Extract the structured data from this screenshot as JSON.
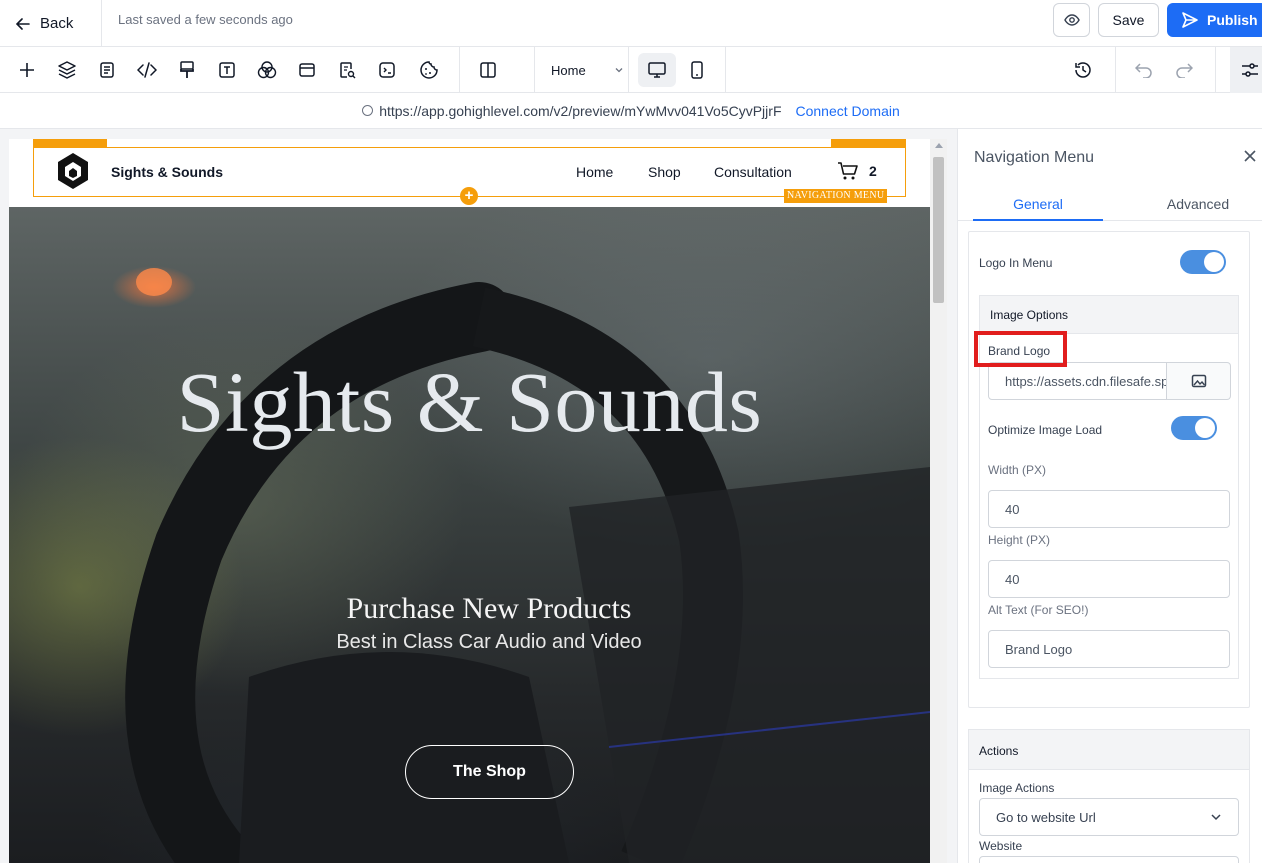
{
  "topbar": {
    "back_label": "Back",
    "saved_status": "Last saved a few seconds ago",
    "save_label": "Save",
    "publish_label": "Publish"
  },
  "toolbar": {
    "page_select": "Home"
  },
  "urlbar": {
    "url": "https://app.gohighlevel.com/v2/preview/mYwMvv041Vo5CyvPjjrF",
    "connect_label": "Connect Domain"
  },
  "site": {
    "brand": "Sights & Sounds",
    "menu": [
      "Home",
      "Shop",
      "Consultation"
    ],
    "cart_count": "2",
    "nav_tag": "NAVIGATION MENU",
    "hero_title": "Sights & Sounds",
    "hero_subtitle": "Purchase New Products",
    "hero_tagline": "Best in Class Car Audio and Video",
    "cta_label": "The Shop"
  },
  "panel": {
    "title": "Navigation Menu",
    "tabs": [
      "General",
      "Advanced"
    ],
    "logo_in_menu_label": "Logo In Menu",
    "logo_in_menu_on": true,
    "image_options_header": "Image Options",
    "brand_logo_label": "Brand Logo",
    "brand_logo_value": "https://assets.cdn.filesafe.space",
    "optimize_label": "Optimize Image Load",
    "optimize_on": true,
    "width_label": "Width (PX)",
    "width_value": "40",
    "height_label": "Height (PX)",
    "height_value": "40",
    "alt_label": "Alt Text (For SEO!)",
    "alt_value": "Brand Logo",
    "actions_header": "Actions",
    "image_actions_label": "Image Actions",
    "image_actions_value": "Go to website Url",
    "website_label": "Website"
  },
  "colors": {
    "accent": "#1d6cf5",
    "selection": "#f59e0b",
    "highlight": "#e11d1d",
    "toggle": "#4a8fe0"
  }
}
